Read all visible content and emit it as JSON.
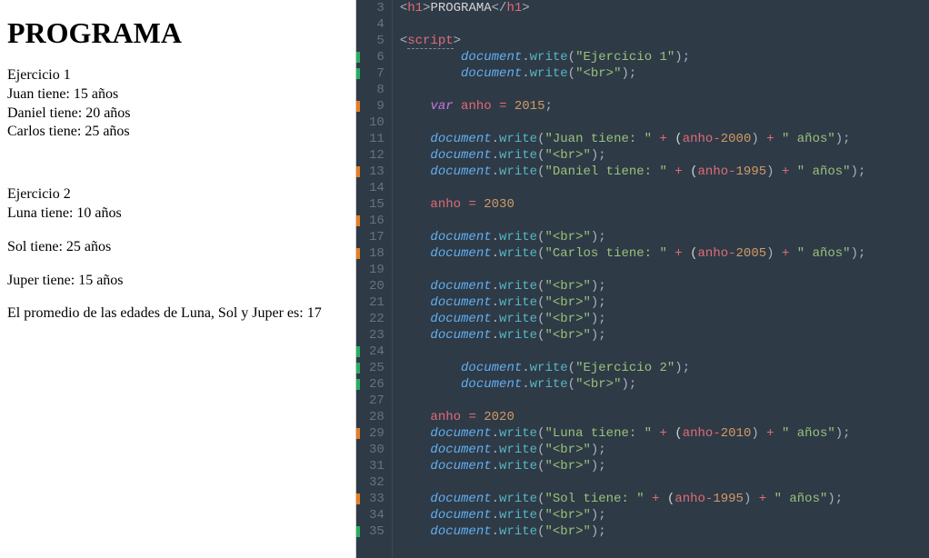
{
  "preview": {
    "title": "PROGRAMA",
    "ex1_label": "Ejercicio 1",
    "juan": "Juan tiene: 15 años",
    "daniel": "Daniel tiene: 20 años",
    "carlos": "Carlos tiene: 25 años",
    "ex2_label": "Ejercicio 2",
    "luna": "Luna tiene: 10 años",
    "sol": "Sol tiene: 25 años",
    "juper": "Juper tiene: 15 años",
    "promedio": "El promedio de las edades de Luna, Sol y Juper es: 17"
  },
  "editor": {
    "first_line_number": 3,
    "lines": [
      {
        "n": 3,
        "mark": "",
        "tokens": [
          [
            "t-punc",
            "<"
          ],
          [
            "t-tagname",
            "h1"
          ],
          [
            "t-punc",
            ">"
          ],
          [
            "t-text",
            "PROGRAMA"
          ],
          [
            "t-punc",
            "</"
          ],
          [
            "t-tagname",
            "h1"
          ],
          [
            "t-punc",
            ">"
          ]
        ]
      },
      {
        "n": 4,
        "mark": "",
        "tokens": []
      },
      {
        "n": 5,
        "mark": "",
        "tokens": [
          [
            "t-punc",
            "<"
          ],
          [
            "t-tagname t-squig",
            "script"
          ],
          [
            "t-punc",
            ">"
          ]
        ]
      },
      {
        "n": 6,
        "mark": "green",
        "indent": 8,
        "tokens": [
          [
            "t-obj",
            "document"
          ],
          [
            "t-punc",
            "."
          ],
          [
            "t-func",
            "write"
          ],
          [
            "t-punc",
            "("
          ],
          [
            "t-str",
            "\"Ejercicio 1\""
          ],
          [
            "t-punc",
            ");"
          ]
        ]
      },
      {
        "n": 7,
        "mark": "green",
        "indent": 8,
        "tokens": [
          [
            "t-obj",
            "document"
          ],
          [
            "t-punc",
            "."
          ],
          [
            "t-func",
            "write"
          ],
          [
            "t-punc",
            "("
          ],
          [
            "t-str",
            "\"<br>\""
          ],
          [
            "t-punc",
            ");"
          ]
        ]
      },
      {
        "n": 8,
        "mark": "",
        "tokens": []
      },
      {
        "n": 9,
        "mark": "orange",
        "indent": 4,
        "tokens": [
          [
            "t-kw",
            "var"
          ],
          [
            "t-text",
            " "
          ],
          [
            "t-var",
            "anho"
          ],
          [
            "t-text",
            " "
          ],
          [
            "t-op",
            "="
          ],
          [
            "t-text",
            " "
          ],
          [
            "t-num",
            "2015"
          ],
          [
            "t-punc",
            ";"
          ]
        ]
      },
      {
        "n": 10,
        "mark": "",
        "tokens": []
      },
      {
        "n": 11,
        "mark": "",
        "indent": 4,
        "tokens": [
          [
            "t-obj",
            "document"
          ],
          [
            "t-punc",
            "."
          ],
          [
            "t-func",
            "write"
          ],
          [
            "t-punc",
            "("
          ],
          [
            "t-str",
            "\"Juan tiene: \""
          ],
          [
            "t-text",
            " "
          ],
          [
            "t-op",
            "+"
          ],
          [
            "t-text",
            " ("
          ],
          [
            "t-var",
            "anho"
          ],
          [
            "t-op",
            "-"
          ],
          [
            "t-num",
            "2000"
          ],
          [
            "t-punc",
            ") "
          ],
          [
            "t-op",
            "+"
          ],
          [
            "t-text",
            " "
          ],
          [
            "t-str",
            "\" años\""
          ],
          [
            "t-punc",
            ");"
          ]
        ]
      },
      {
        "n": 12,
        "mark": "",
        "indent": 4,
        "tokens": [
          [
            "t-obj",
            "document"
          ],
          [
            "t-punc",
            "."
          ],
          [
            "t-func",
            "write"
          ],
          [
            "t-punc",
            "("
          ],
          [
            "t-str",
            "\"<br>\""
          ],
          [
            "t-punc",
            ");"
          ]
        ]
      },
      {
        "n": 13,
        "mark": "orange",
        "indent": 4,
        "tokens": [
          [
            "t-obj",
            "document"
          ],
          [
            "t-punc",
            "."
          ],
          [
            "t-func",
            "write"
          ],
          [
            "t-punc",
            "("
          ],
          [
            "t-str",
            "\"Daniel tiene: \""
          ],
          [
            "t-text",
            " "
          ],
          [
            "t-op",
            "+"
          ],
          [
            "t-text",
            " ("
          ],
          [
            "t-var",
            "anho"
          ],
          [
            "t-op",
            "-"
          ],
          [
            "t-num",
            "1995"
          ],
          [
            "t-punc",
            ") "
          ],
          [
            "t-op",
            "+"
          ],
          [
            "t-text",
            " "
          ],
          [
            "t-str",
            "\" años\""
          ],
          [
            "t-punc",
            ");"
          ]
        ]
      },
      {
        "n": 14,
        "mark": "",
        "tokens": []
      },
      {
        "n": 15,
        "mark": "",
        "indent": 4,
        "tokens": [
          [
            "t-var",
            "anho"
          ],
          [
            "t-text",
            " "
          ],
          [
            "t-op",
            "="
          ],
          [
            "t-text",
            " "
          ],
          [
            "t-num",
            "2030"
          ]
        ]
      },
      {
        "n": 16,
        "mark": "orange",
        "tokens": []
      },
      {
        "n": 17,
        "mark": "",
        "indent": 4,
        "tokens": [
          [
            "t-obj",
            "document"
          ],
          [
            "t-punc",
            "."
          ],
          [
            "t-func",
            "write"
          ],
          [
            "t-punc",
            "("
          ],
          [
            "t-str",
            "\"<br>\""
          ],
          [
            "t-punc",
            ");"
          ]
        ]
      },
      {
        "n": 18,
        "mark": "orange",
        "indent": 4,
        "tokens": [
          [
            "t-obj",
            "document"
          ],
          [
            "t-punc",
            "."
          ],
          [
            "t-func",
            "write"
          ],
          [
            "t-punc",
            "("
          ],
          [
            "t-str",
            "\"Carlos tiene: \""
          ],
          [
            "t-text",
            " "
          ],
          [
            "t-op",
            "+"
          ],
          [
            "t-text",
            " ("
          ],
          [
            "t-var",
            "anho"
          ],
          [
            "t-op",
            "-"
          ],
          [
            "t-num",
            "2005"
          ],
          [
            "t-punc",
            ") "
          ],
          [
            "t-op",
            "+"
          ],
          [
            "t-text",
            " "
          ],
          [
            "t-str",
            "\" años\""
          ],
          [
            "t-punc",
            ");"
          ]
        ]
      },
      {
        "n": 19,
        "mark": "",
        "tokens": []
      },
      {
        "n": 20,
        "mark": "",
        "indent": 4,
        "tokens": [
          [
            "t-obj",
            "document"
          ],
          [
            "t-punc",
            "."
          ],
          [
            "t-func",
            "write"
          ],
          [
            "t-punc",
            "("
          ],
          [
            "t-str",
            "\"<br>\""
          ],
          [
            "t-punc",
            ");"
          ]
        ]
      },
      {
        "n": 21,
        "mark": "",
        "indent": 4,
        "tokens": [
          [
            "t-obj",
            "document"
          ],
          [
            "t-punc",
            "."
          ],
          [
            "t-func",
            "write"
          ],
          [
            "t-punc",
            "("
          ],
          [
            "t-str",
            "\"<br>\""
          ],
          [
            "t-punc",
            ");"
          ]
        ]
      },
      {
        "n": 22,
        "mark": "",
        "indent": 4,
        "tokens": [
          [
            "t-obj",
            "document"
          ],
          [
            "t-punc",
            "."
          ],
          [
            "t-func",
            "write"
          ],
          [
            "t-punc",
            "("
          ],
          [
            "t-str",
            "\"<br>\""
          ],
          [
            "t-punc",
            ");"
          ]
        ]
      },
      {
        "n": 23,
        "mark": "",
        "indent": 4,
        "tokens": [
          [
            "t-obj",
            "document"
          ],
          [
            "t-punc",
            "."
          ],
          [
            "t-func",
            "write"
          ],
          [
            "t-punc",
            "("
          ],
          [
            "t-str",
            "\"<br>\""
          ],
          [
            "t-punc",
            ");"
          ]
        ]
      },
      {
        "n": 24,
        "mark": "green",
        "tokens": []
      },
      {
        "n": 25,
        "mark": "green",
        "indent": 8,
        "tokens": [
          [
            "t-obj",
            "document"
          ],
          [
            "t-punc",
            "."
          ],
          [
            "t-func",
            "write"
          ],
          [
            "t-punc",
            "("
          ],
          [
            "t-str",
            "\"Ejercicio 2\""
          ],
          [
            "t-punc",
            ");"
          ]
        ]
      },
      {
        "n": 26,
        "mark": "green",
        "indent": 8,
        "tokens": [
          [
            "t-obj",
            "document"
          ],
          [
            "t-punc",
            "."
          ],
          [
            "t-func",
            "write"
          ],
          [
            "t-punc",
            "("
          ],
          [
            "t-str",
            "\"<br>\""
          ],
          [
            "t-punc",
            ");"
          ]
        ]
      },
      {
        "n": 27,
        "mark": "",
        "tokens": []
      },
      {
        "n": 28,
        "mark": "",
        "indent": 4,
        "tokens": [
          [
            "t-var",
            "anho"
          ],
          [
            "t-text",
            " "
          ],
          [
            "t-op",
            "="
          ],
          [
            "t-text",
            " "
          ],
          [
            "t-num",
            "2020"
          ]
        ]
      },
      {
        "n": 29,
        "mark": "orange",
        "indent": 4,
        "tokens": [
          [
            "t-obj",
            "document"
          ],
          [
            "t-punc",
            "."
          ],
          [
            "t-func",
            "write"
          ],
          [
            "t-punc",
            "("
          ],
          [
            "t-str",
            "\"Luna tiene: \""
          ],
          [
            "t-text",
            " "
          ],
          [
            "t-op",
            "+"
          ],
          [
            "t-text",
            " ("
          ],
          [
            "t-var",
            "anho"
          ],
          [
            "t-op",
            "-"
          ],
          [
            "t-num",
            "2010"
          ],
          [
            "t-punc",
            ") "
          ],
          [
            "t-op",
            "+"
          ],
          [
            "t-text",
            " "
          ],
          [
            "t-str",
            "\" años\""
          ],
          [
            "t-punc",
            ");"
          ]
        ]
      },
      {
        "n": 30,
        "mark": "",
        "indent": 4,
        "tokens": [
          [
            "t-obj",
            "document"
          ],
          [
            "t-punc",
            "."
          ],
          [
            "t-func",
            "write"
          ],
          [
            "t-punc",
            "("
          ],
          [
            "t-str",
            "\"<br>\""
          ],
          [
            "t-punc",
            ");"
          ]
        ]
      },
      {
        "n": 31,
        "mark": "",
        "indent": 4,
        "tokens": [
          [
            "t-obj",
            "document"
          ],
          [
            "t-punc",
            "."
          ],
          [
            "t-func",
            "write"
          ],
          [
            "t-punc",
            "("
          ],
          [
            "t-str",
            "\"<br>\""
          ],
          [
            "t-punc",
            ");"
          ]
        ]
      },
      {
        "n": 32,
        "mark": "",
        "tokens": []
      },
      {
        "n": 33,
        "mark": "orange",
        "indent": 4,
        "tokens": [
          [
            "t-obj",
            "document"
          ],
          [
            "t-punc",
            "."
          ],
          [
            "t-func",
            "write"
          ],
          [
            "t-punc",
            "("
          ],
          [
            "t-str",
            "\"Sol tiene: \""
          ],
          [
            "t-text",
            " "
          ],
          [
            "t-op",
            "+"
          ],
          [
            "t-text",
            " ("
          ],
          [
            "t-var",
            "anho"
          ],
          [
            "t-op",
            "-"
          ],
          [
            "t-num",
            "1995"
          ],
          [
            "t-punc",
            ") "
          ],
          [
            "t-op",
            "+"
          ],
          [
            "t-text",
            " "
          ],
          [
            "t-str",
            "\" años\""
          ],
          [
            "t-punc",
            ");"
          ]
        ]
      },
      {
        "n": 34,
        "mark": "",
        "indent": 4,
        "tokens": [
          [
            "t-obj",
            "document"
          ],
          [
            "t-punc",
            "."
          ],
          [
            "t-func",
            "write"
          ],
          [
            "t-punc",
            "("
          ],
          [
            "t-str",
            "\"<br>\""
          ],
          [
            "t-punc",
            ");"
          ]
        ]
      },
      {
        "n": 35,
        "mark": "green",
        "indent": 4,
        "tokens": [
          [
            "t-obj",
            "document"
          ],
          [
            "t-punc",
            "."
          ],
          [
            "t-func",
            "write"
          ],
          [
            "t-punc",
            "("
          ],
          [
            "t-str",
            "\"<br>\""
          ],
          [
            "t-punc",
            ");"
          ]
        ]
      }
    ]
  }
}
